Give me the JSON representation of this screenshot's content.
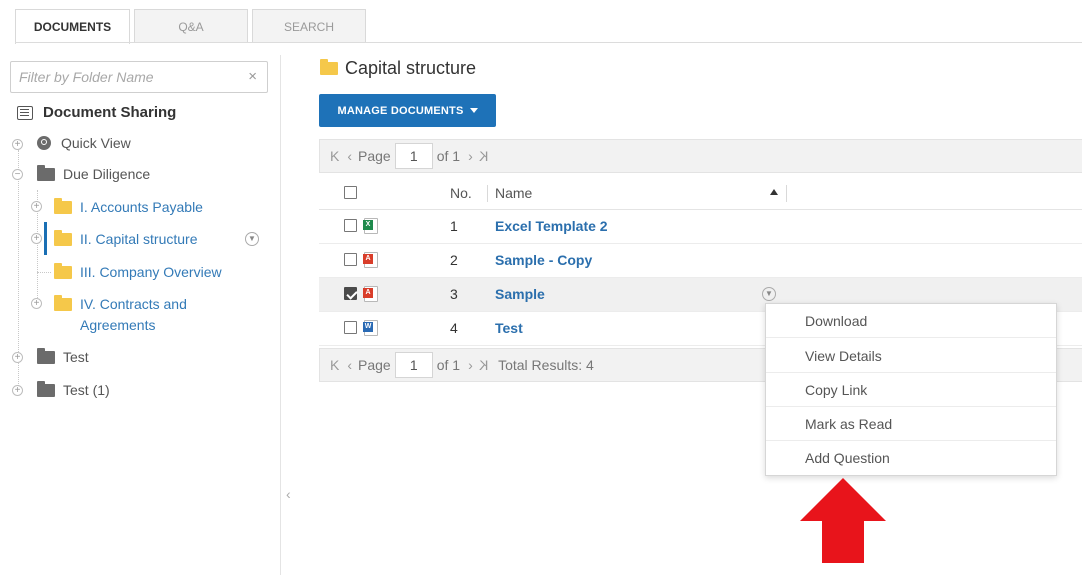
{
  "tabs": [
    {
      "label": "DOCUMENTS",
      "active": true
    },
    {
      "label": "Q&A",
      "active": false
    },
    {
      "label": "SEARCH",
      "active": false
    }
  ],
  "filter": {
    "placeholder": "Filter by Folder Name",
    "clear_symbol": "×"
  },
  "tree": {
    "root_label": "Document Sharing",
    "items": [
      {
        "label": "Quick View",
        "icon": "magnifier-icon"
      },
      {
        "label": "Due Diligence",
        "icon": "folder-icon",
        "expanded": true
      },
      {
        "label": "I. Accounts Payable",
        "icon": "folder-icon"
      },
      {
        "label": "II. Capital structure",
        "icon": "folder-icon",
        "selected": true
      },
      {
        "label": "III. Company Overview",
        "icon": "folder-icon"
      },
      {
        "label": "IV. Contracts and",
        "label_line2": "Agreements",
        "icon": "folder-icon"
      },
      {
        "label": "Test",
        "icon": "folder-icon"
      },
      {
        "label": "Test (1)",
        "icon": "folder-icon"
      }
    ],
    "expand_symbol": "+",
    "collapse_symbol": "−"
  },
  "collapse_pane_symbol": "‹",
  "main": {
    "folder_title": "Capital structure",
    "manage_button": "MANAGE DOCUMENTS",
    "pager_top": {
      "first": "K",
      "prev": "‹",
      "page_label": "Page",
      "page": "1",
      "of": "of 1",
      "next": "›",
      "last": "K"
    },
    "pager_bottom": {
      "first": "K",
      "prev": "‹",
      "page_label": "Page",
      "page": "1",
      "of": "of 1",
      "next": "›",
      "last": "K",
      "total": "Total Results: 4"
    },
    "columns": {
      "no": "No.",
      "name": "Name"
    },
    "rows": [
      {
        "no": "1",
        "name": "Excel Template 2",
        "type": "excel",
        "badge": "X",
        "checked": false
      },
      {
        "no": "2",
        "name": "Sample - Copy",
        "type": "pdf",
        "badge": "A",
        "checked": false
      },
      {
        "no": "3",
        "name": "Sample",
        "type": "pdf",
        "badge": "A",
        "checked": true
      },
      {
        "no": "4",
        "name": "Test",
        "type": "word",
        "badge": "W",
        "checked": false
      }
    ]
  },
  "context_menu": {
    "items": [
      "Download",
      "View Details",
      "Copy Link",
      "Mark as Read",
      "Add Question"
    ]
  },
  "colors": {
    "accent": "#1e72b8",
    "link": "#2b6fad",
    "folder_yellow": "#f5c84a",
    "folder_gray": "#6b6b6b",
    "annotation_arrow": "#e8141b"
  }
}
